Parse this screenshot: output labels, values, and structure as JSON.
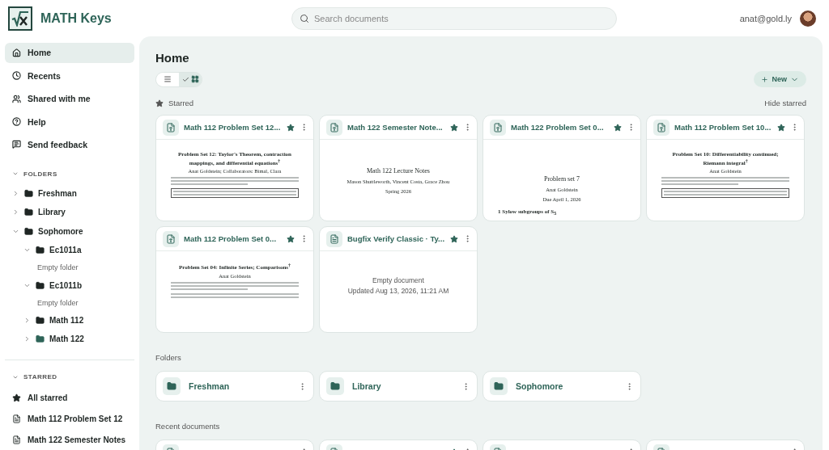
{
  "header": {
    "logo_text": "MATH Keys",
    "search": {
      "placeholder": "Search documents"
    },
    "user_email": "anat@gold.ly"
  },
  "nav": [
    {
      "label": "Home",
      "kind": "home",
      "selected": true
    },
    {
      "label": "Recents",
      "kind": "recents",
      "selected": false
    },
    {
      "label": "Shared with me",
      "kind": "shared",
      "selected": false
    },
    {
      "label": "Help",
      "kind": "help",
      "selected": false
    },
    {
      "label": "Send feedback",
      "kind": "feedback",
      "selected": false
    }
  ],
  "folders_section": {
    "title": "FOLDERS",
    "expanded": true,
    "tree": [
      {
        "name": "Freshman",
        "expanded": false,
        "color": "#1f2624"
      },
      {
        "name": "Library",
        "expanded": false,
        "color": "#1f2624"
      },
      {
        "name": "Sophomore",
        "expanded": true,
        "color": "#1f2624",
        "children": [
          {
            "name": "Ec1011a",
            "expanded": true,
            "color": "#1f2624",
            "note": "Empty folder"
          },
          {
            "name": "Ec1011b",
            "expanded": true,
            "color": "#1f2624",
            "note": "Empty folder"
          },
          {
            "name": "Math 112",
            "expanded": false,
            "color": "#1f2624"
          },
          {
            "name": "Math 122",
            "expanded": false,
            "color": "#2e6458"
          }
        ]
      }
    ]
  },
  "starred_section": {
    "title": "STARRED",
    "expanded": true,
    "items": [
      {
        "label": "All starred",
        "kind": "star"
      },
      {
        "label": "Math 112 Problem Set 12",
        "kind": "doc"
      },
      {
        "label": "Math 122 Semester Notes",
        "kind": "doc"
      }
    ]
  },
  "main": {
    "title": "Home",
    "view_toggle": [
      {
        "kind": "list",
        "selected": false
      },
      {
        "kind": "grid",
        "selected": true
      }
    ],
    "new_button": "New",
    "starred": {
      "title": "Starred",
      "hide_label": "Hide starred",
      "cards": [
        {
          "title": "Math 112 Problem Set 12...",
          "kind": "math",
          "starred": true,
          "preview": {
            "kind": "article",
            "heading": "Problem Set 12: Taylor's Theorem, contraction mappings, and differential equations$^{†}$",
            "author": "Anat Goldstein; Collaborators: Bimal, Clara",
            "boxed": true
          }
        },
        {
          "title": "Math 122 Semester Note...",
          "kind": "math",
          "starred": true,
          "preview": {
            "kind": "titlepage",
            "title": "Math 122 Lecture Notes",
            "author": "Mason Shuttleworth, Vincent Costa, Grace Zhou",
            "date": "Spring 2026"
          }
        },
        {
          "title": "Math 122 Problem Set 0...",
          "kind": "math",
          "starred": true,
          "preview": {
            "kind": "titlepage",
            "title": "Problem set 7",
            "author": "Anat Goldstein",
            "date": "Due April 1, 2026",
            "section": "1   Sylow subgroups of S$_{5}$"
          }
        },
        {
          "title": "Math 112 Problem Set 10...",
          "kind": "math",
          "starred": true,
          "preview": {
            "kind": "article",
            "heading": "Problem Set 10: Differentiability continued; Riemann integral$^{†}$",
            "author": "Anat Goldstein",
            "boxed": true
          }
        },
        {
          "title": "Math 112 Problem Set 0...",
          "kind": "math",
          "starred": true,
          "preview": {
            "kind": "article",
            "heading": "Problem Set 04: Infinite Series; Comparisons$^{†}$",
            "author": "Anat Goldstein",
            "boxed": false
          }
        },
        {
          "title": "Bugfix Verify Classic · Ty...",
          "kind": "text",
          "starred": true,
          "preview": {
            "kind": "empty",
            "text": "Empty document",
            "updated": "Updated Aug 13, 2026, 11:21 AM"
          }
        }
      ]
    },
    "folders_title": "Folders",
    "folders": [
      {
        "name": "Freshman"
      },
      {
        "name": "Library"
      },
      {
        "name": "Sophomore"
      }
    ],
    "recent_title": "Recent documents",
    "recent": [
      {
        "starred": false
      },
      {
        "starred": true
      },
      {
        "starred": false
      },
      {
        "starred": false
      }
    ]
  }
}
